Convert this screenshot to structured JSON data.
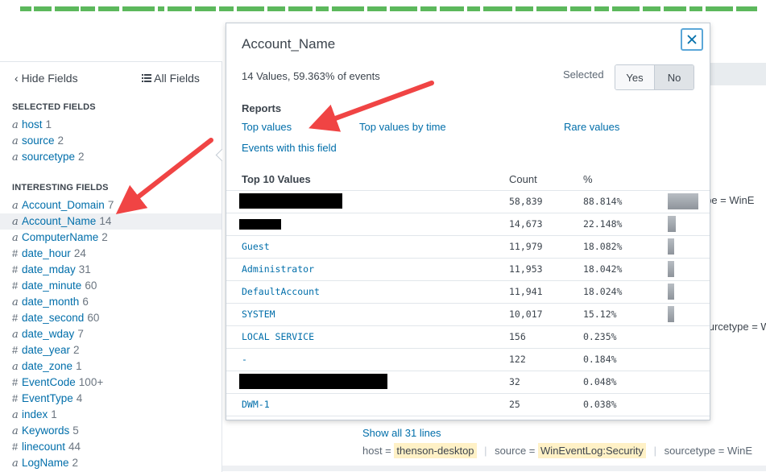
{
  "timeline": {
    "color": "#5cb85c"
  },
  "sidebar": {
    "hide_fields_label": "Hide Fields",
    "all_fields_label": "All Fields",
    "selected_title": "SELECTED FIELDS",
    "selected_fields": [
      {
        "type": "a",
        "name": "host",
        "count": "1"
      },
      {
        "type": "a",
        "name": "source",
        "count": "2"
      },
      {
        "type": "a",
        "name": "sourcetype",
        "count": "2"
      }
    ],
    "interesting_title": "INTERESTING FIELDS",
    "interesting_fields": [
      {
        "type": "a",
        "name": "Account_Domain",
        "count": "7"
      },
      {
        "type": "a",
        "name": "Account_Name",
        "count": "14"
      },
      {
        "type": "a",
        "name": "ComputerName",
        "count": "2"
      },
      {
        "type": "#",
        "name": "date_hour",
        "count": "24"
      },
      {
        "type": "#",
        "name": "date_mday",
        "count": "31"
      },
      {
        "type": "#",
        "name": "date_minute",
        "count": "60"
      },
      {
        "type": "a",
        "name": "date_month",
        "count": "6"
      },
      {
        "type": "#",
        "name": "date_second",
        "count": "60"
      },
      {
        "type": "a",
        "name": "date_wday",
        "count": "7"
      },
      {
        "type": "#",
        "name": "date_year",
        "count": "2"
      },
      {
        "type": "a",
        "name": "date_zone",
        "count": "1"
      },
      {
        "type": "#",
        "name": "EventCode",
        "count": "100+"
      },
      {
        "type": "#",
        "name": "EventType",
        "count": "4"
      },
      {
        "type": "a",
        "name": "index",
        "count": "1"
      },
      {
        "type": "a",
        "name": "Keywords",
        "count": "5"
      },
      {
        "type": "#",
        "name": "linecount",
        "count": "44"
      },
      {
        "type": "a",
        "name": "LogName",
        "count": "2"
      }
    ]
  },
  "background": {
    "sourcetype_1": "type = WinE",
    "sourcetype_2": "sourcetype = Wi",
    "show_all": "Show all 31 lines",
    "host_key": "host =",
    "host_val": "thenson-desktop",
    "source_key": "source =",
    "source_val": "WinEventLog:Security",
    "sourcetype_key": "sourcetype =",
    "sourcetype_val": "WinE"
  },
  "popup": {
    "title": "Account_Name",
    "summary": "14 Values, 59.363% of events",
    "selected_label": "Selected",
    "yes_label": "Yes",
    "no_label": "No",
    "reports_title": "Reports",
    "links": {
      "top_values": "Top values",
      "top_values_by_time": "Top values by time",
      "rare_values": "Rare values",
      "events_with_field": "Events with this field"
    },
    "table_title": "Top 10 Values",
    "col_count": "Count",
    "col_pct": "%",
    "rows": [
      {
        "value": "",
        "redacted": true,
        "count": "58,839",
        "pct": "88.814%",
        "ratio": 0.88814
      },
      {
        "value": "",
        "redacted": true,
        "count": "14,673",
        "pct": "22.148%",
        "ratio": 0.22148
      },
      {
        "value": "Guest",
        "redacted": false,
        "count": "11,979",
        "pct": "18.082%",
        "ratio": 0.18082
      },
      {
        "value": "Administrator",
        "redacted": false,
        "count": "11,953",
        "pct": "18.042%",
        "ratio": 0.18042
      },
      {
        "value": "DefaultAccount",
        "redacted": false,
        "count": "11,941",
        "pct": "18.024%",
        "ratio": 0.18024
      },
      {
        "value": "SYSTEM",
        "redacted": false,
        "count": "10,017",
        "pct": "15.12%",
        "ratio": 0.1512
      },
      {
        "value": "LOCAL SERVICE",
        "redacted": false,
        "count": "156",
        "pct": "0.235%",
        "ratio": 0.00235
      },
      {
        "value": "-",
        "redacted": false,
        "count": "122",
        "pct": "0.184%",
        "ratio": 0.00184
      },
      {
        "value": "",
        "redacted": true,
        "count": "32",
        "pct": "0.048%",
        "ratio": 0.00048
      },
      {
        "value": "DWM-1",
        "redacted": false,
        "count": "25",
        "pct": "0.038%",
        "ratio": 0.00038
      }
    ]
  },
  "annotations": {
    "arrow_color": "#f04444"
  }
}
